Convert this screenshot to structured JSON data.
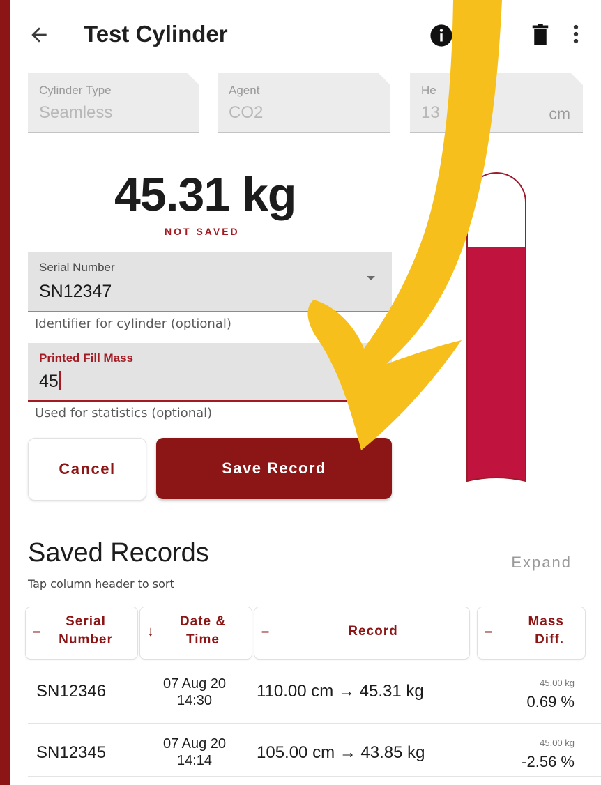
{
  "header": {
    "title": "Test Cylinder"
  },
  "colors": {
    "frame": "#8c1515",
    "accent": "#a31a22",
    "fill": "#c0133e",
    "arrow": "#f6bf1b"
  },
  "icons": [
    "back-arrow-icon",
    "info-icon",
    "delete-icon",
    "more-vert-icon"
  ],
  "fields": {
    "cylinder_type": {
      "label": "Cylinder Type",
      "value": "Seamless"
    },
    "agent": {
      "label": "Agent",
      "value": "CO2"
    },
    "height": {
      "label": "He",
      "value": "13",
      "suffix": "cm"
    }
  },
  "reading": {
    "weight": "45.31 kg",
    "status": "NOT SAVED",
    "fill_level": 0.76
  },
  "serial": {
    "label": "Serial Number",
    "value": "SN12347",
    "helper": "Identifier for cylinder (optional)"
  },
  "fill_mass": {
    "label": "Printed Fill Mass",
    "value": "45",
    "helper": "Used for statistics (optional)"
  },
  "buttons": {
    "cancel": "Cancel",
    "save": "Save Record"
  },
  "records": {
    "title": "Saved Records",
    "expand": "Expand",
    "hint": "Tap column header to sort",
    "columns": [
      {
        "sym": "–",
        "label": "Serial\nNumber"
      },
      {
        "sym": "↓",
        "label": "Date &\nTime"
      },
      {
        "sym": "–",
        "label": "Record"
      },
      {
        "sym": "–",
        "label": "Mass\nDiff."
      }
    ],
    "rows": [
      {
        "serial": "SN12346",
        "date": "07 Aug 20",
        "time": "14:30",
        "record": "110.00 cm → 45.31 kg",
        "printed": "45.00 kg",
        "diff": "0.69 %"
      },
      {
        "serial": "SN12345",
        "date": "07 Aug 20",
        "time": "14:14",
        "record": "105.00 cm → 43.85 kg",
        "printed": "45.00 kg",
        "diff": "-2.56 %"
      }
    ]
  }
}
